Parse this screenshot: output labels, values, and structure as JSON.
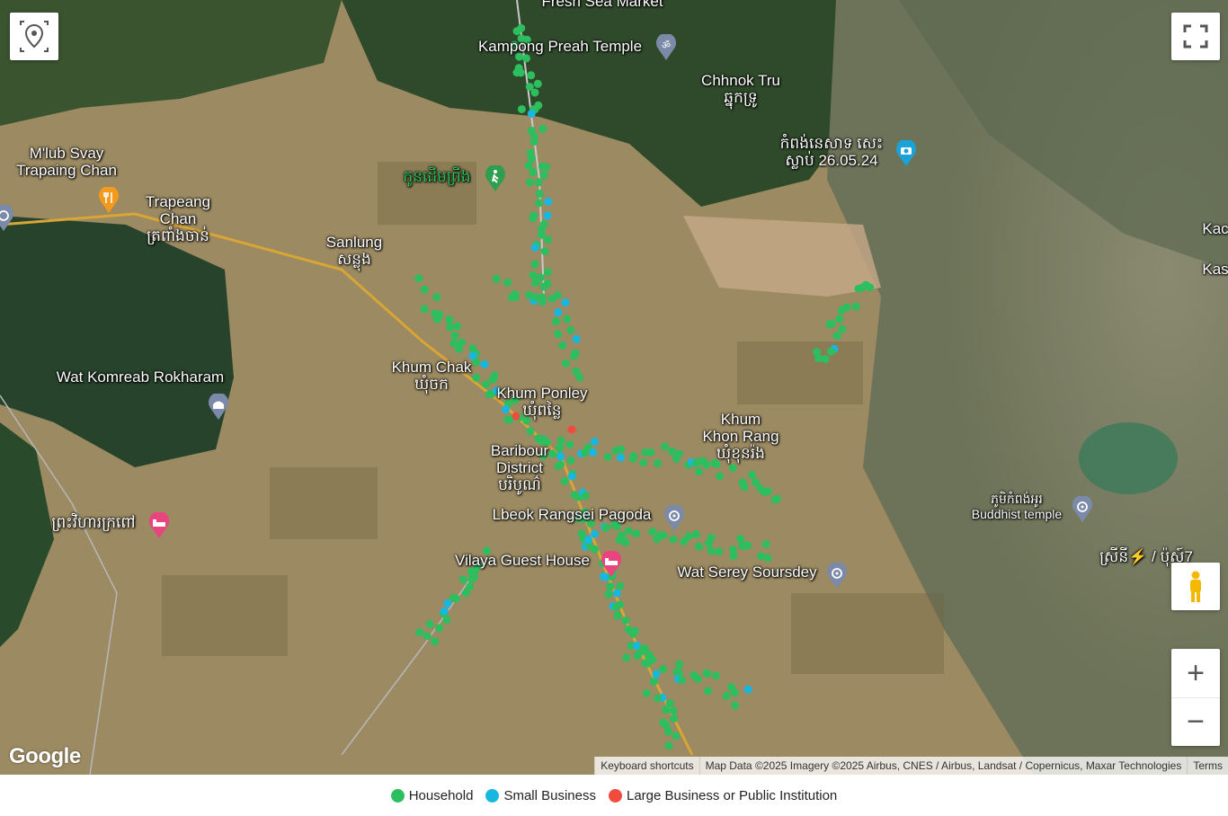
{
  "map": {
    "labels": {
      "fresh_sea_market": "Fresh Sea Market",
      "kampong_preah_temple": "Kampong Preah Temple",
      "chhnok_tru": "Chhnok Tru",
      "chhnok_tru_km": "ឆ្នុកទ្រូ",
      "ferry_poi": "កំពង់នេសាទ សេះ",
      "ferry_poi_2": "ស្លាប់ 26.05.24",
      "mlub_svay": "M'lub Svay",
      "mlub_svay_2": "Trapaing Chan",
      "trapeang_chan": "Trapeang",
      "trapeang_chan_2": "Chan",
      "trapeang_chan_km": "ត្រពាំងចាន់",
      "kon_daem_pring": "កូនដើមព្រីង",
      "sanlung": "Sanlung",
      "sanlung_km": "សន្លុង",
      "wat_komreab": "Wat Komreab Rokharam",
      "khum_chak": "Khum Chak",
      "khum_chak_km": "ឃុំចក",
      "khum_ponley": "Khum Ponley",
      "khum_ponley_km": "ឃុំពន្លៃ",
      "baribour": "Baribour",
      "baribour_2": "District",
      "baribour_km": "បរិបូណ៌",
      "khum_khon_rang": "Khum",
      "khum_khon_rang_2": "Khon Rang",
      "khum_khon_rang_km": "ឃុំខុនរ៉ង",
      "lbeok_pagoda": "Lbeok Rangsei Pagoda",
      "vilaya": "Vilaya Guest House",
      "wat_serey": "Wat Serey Soursdey",
      "preah_vihear_krabao": "ព្រះវិហារក្រពៅ",
      "kompong_buddhist_km": "ភូមិកំពង់អូរ",
      "kompong_buddhist": "Buddhist temple",
      "edge_shop": "ស្រីនី⚡ / ប៉ុស្ត៍7",
      "edge_kac": "Kac",
      "edge_kas": "Kas"
    },
    "icons": {
      "temple": "om-icon",
      "hiker": "hiking-icon",
      "camera": "camera-icon",
      "restaurant": "fork-knife-icon",
      "hotel": "bed-icon",
      "buddhist": "dharma-wheel-icon",
      "mosque": "mosque-icon"
    }
  },
  "controls": {
    "my_location": "my-location-icon",
    "fullscreen": "fullscreen-icon",
    "pegman": "pegman-icon",
    "zoom_in": "+",
    "zoom_out": "−"
  },
  "attribution": {
    "google": "Google",
    "keyboard": "Keyboard shortcuts",
    "map_data": "Map Data ©2025 Imagery ©2025 Airbus, CNES / Airbus, Landsat / Copernicus, Maxar Technologies",
    "terms": "Terms"
  },
  "legend": {
    "items": [
      {
        "label": "Household",
        "color": "#2dbe60"
      },
      {
        "label": "Small Business",
        "color": "#18b7e0"
      },
      {
        "label": "Large Business or Public Institution",
        "color": "#f24a3d"
      }
    ]
  },
  "colors": {
    "household": "#2dbe60",
    "small_business": "#18b7e0",
    "large_business": "#f24a3d",
    "road": "#e6b43a"
  }
}
